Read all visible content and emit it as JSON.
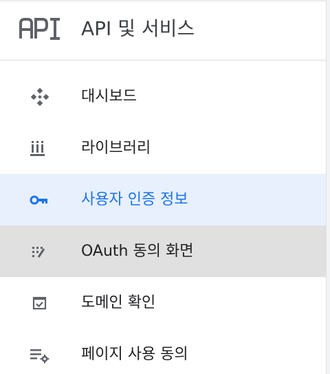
{
  "header": {
    "logo_text": "API",
    "title": "API 및 서비스"
  },
  "nav": {
    "items": [
      {
        "label": "대시보드",
        "icon": "dashboard-icon",
        "state": "normal"
      },
      {
        "label": "라이브러리",
        "icon": "library-icon",
        "state": "normal"
      },
      {
        "label": "사용자 인증 정보",
        "icon": "key-icon",
        "state": "selected"
      },
      {
        "label": "OAuth 동의 화면",
        "icon": "oauth-consent-icon",
        "state": "hovered"
      },
      {
        "label": "도메인 확인",
        "icon": "domain-check-icon",
        "state": "normal"
      },
      {
        "label": "페이지 사용 동의",
        "icon": "page-settings-icon",
        "state": "normal"
      }
    ]
  },
  "colors": {
    "selected_text": "#1a73e8",
    "selected_bg": "#e8f0fe",
    "hover_bg": "#e0e0e0",
    "icon": "#5f6368"
  }
}
